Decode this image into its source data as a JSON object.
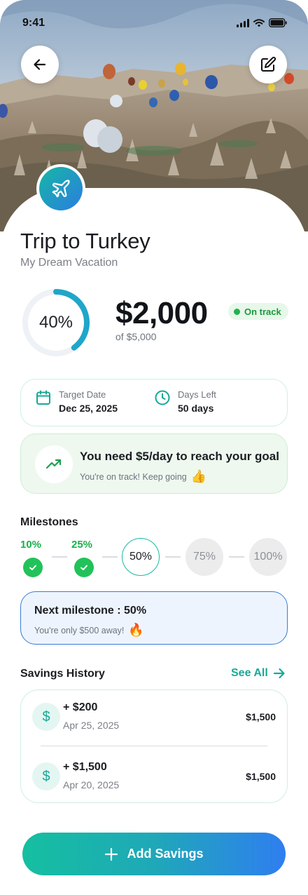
{
  "status_bar": {
    "time": "9:41"
  },
  "goal": {
    "title": "Trip to Turkey",
    "subtitle": "My Dream Vacation",
    "progress_percent": 40,
    "progress_label": "40%",
    "saved_amount": "$2,000",
    "target_amount_text": "of $5,000",
    "status_badge": "On track"
  },
  "dates": {
    "target_label": "Target Date",
    "target_value": "Dec 25, 2025",
    "days_left_label": "Days Left",
    "days_left_value": "50 days"
  },
  "tip": {
    "title": "You need $5/day to reach your goal",
    "subtitle": "You're on track! Keep going",
    "emoji": "👍"
  },
  "milestones": {
    "title": "Milestones",
    "items": [
      {
        "label": "10%",
        "state": "done"
      },
      {
        "label": "25%",
        "state": "done"
      },
      {
        "label": "50%",
        "state": "active"
      },
      {
        "label": "75%",
        "state": "pending"
      },
      {
        "label": "100%",
        "state": "pending"
      }
    ]
  },
  "next_milestone": {
    "title": "Next milestone : 50%",
    "subtitle": "You're only $500 away!",
    "emoji": "🔥"
  },
  "history": {
    "title": "Savings History",
    "see_all": "See All",
    "items": [
      {
        "amount": "+ $200",
        "date": "Apr 25, 2025",
        "total": "$1,500",
        "icon": "$"
      },
      {
        "amount": "+ $1,500",
        "date": "Apr 20, 2025",
        "total": "$1,500",
        "icon": "$"
      }
    ]
  },
  "add_button": {
    "label": "Add Savings"
  },
  "colors": {
    "accent_teal": "#16b7a5",
    "accent_blue": "#2f7ef0",
    "success_green": "#22c25a",
    "badge_bg": "#e7f7ea"
  },
  "icons": {
    "back": "arrow-left-icon",
    "edit": "edit-icon",
    "goal": "airplane-icon",
    "target_date": "calendar-icon",
    "days_left": "clock-icon",
    "tip": "trending-up-icon",
    "see_all": "arrow-right-icon",
    "add": "plus-icon"
  }
}
